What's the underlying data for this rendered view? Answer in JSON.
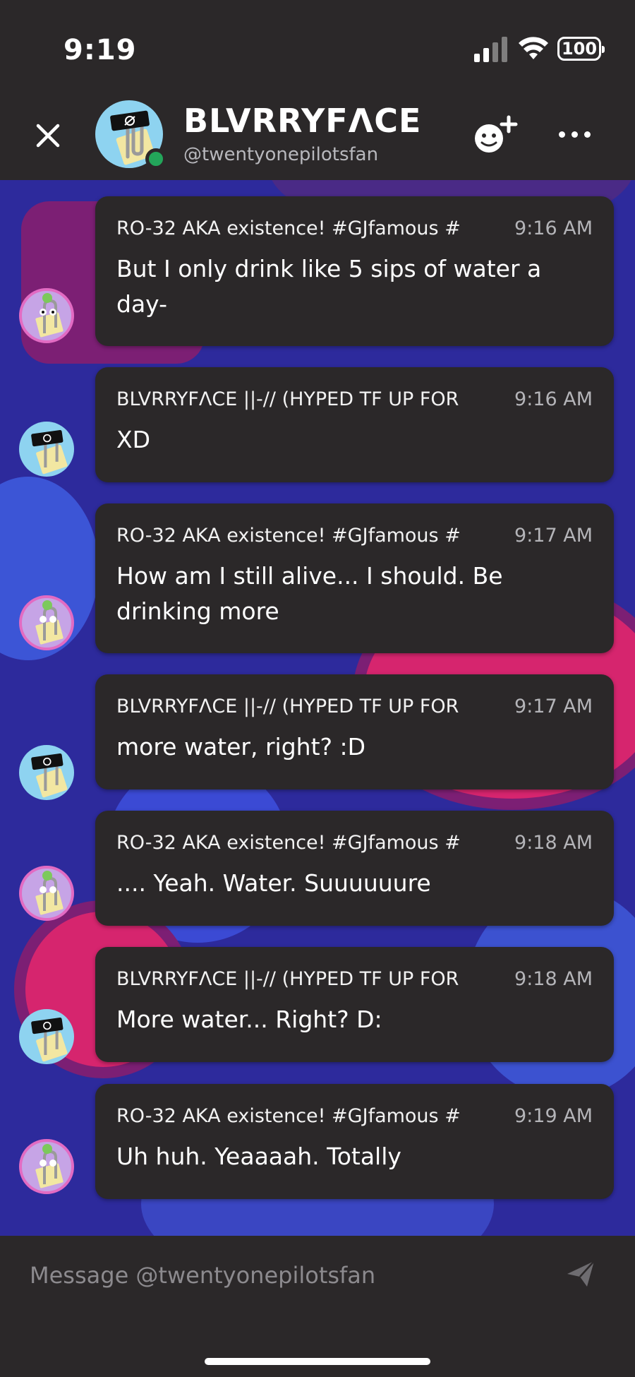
{
  "status_bar": {
    "time": "9:19",
    "battery": "100"
  },
  "header": {
    "name": "BLVRRYFΛCE ||-",
    "handle": "@twentyonepilotsfan"
  },
  "messages": [
    {
      "author": "RO-32 AKA existence!  #GJfamous  #",
      "time": "9:16 AM",
      "text": "But I only drink like 5 sips of water a day-",
      "sender": "ro"
    },
    {
      "author": "BLVRRYFΛCE ||-// (HYPED TF UP FOR",
      "time": "9:16 AM",
      "text": "XD",
      "sender": "blurry"
    },
    {
      "author": "RO-32 AKA existence!  #GJfamous  #",
      "time": "9:17 AM",
      "text": "How am I still alive... I should. Be drinking more",
      "sender": "ro"
    },
    {
      "author": "BLVRRYFΛCE ||-// (HYPED TF UP FOR",
      "time": "9:17 AM",
      "text": "more water, right? :D",
      "sender": "blurry"
    },
    {
      "author": "RO-32 AKA existence!  #GJfamous  #",
      "time": "9:18 AM",
      "text": ".... Yeah. Water. Suuuuuure",
      "sender": "ro"
    },
    {
      "author": "BLVRRYFΛCE ||-// (HYPED TF UP FOR",
      "time": "9:18 AM",
      "text": "More water... Right? D:",
      "sender": "blurry"
    },
    {
      "author": "RO-32 AKA existence!  #GJfamous  #",
      "time": "9:19 AM",
      "text": "Uh huh. Yeaaaah. Totally",
      "sender": "ro"
    }
  ],
  "composer": {
    "placeholder": "Message @twentyonepilotsfan"
  },
  "colors": {
    "bar": "#2b2829",
    "chat_bg": "#2d2a9c",
    "accent_pink": "#d6256e",
    "online": "#23a55a"
  }
}
